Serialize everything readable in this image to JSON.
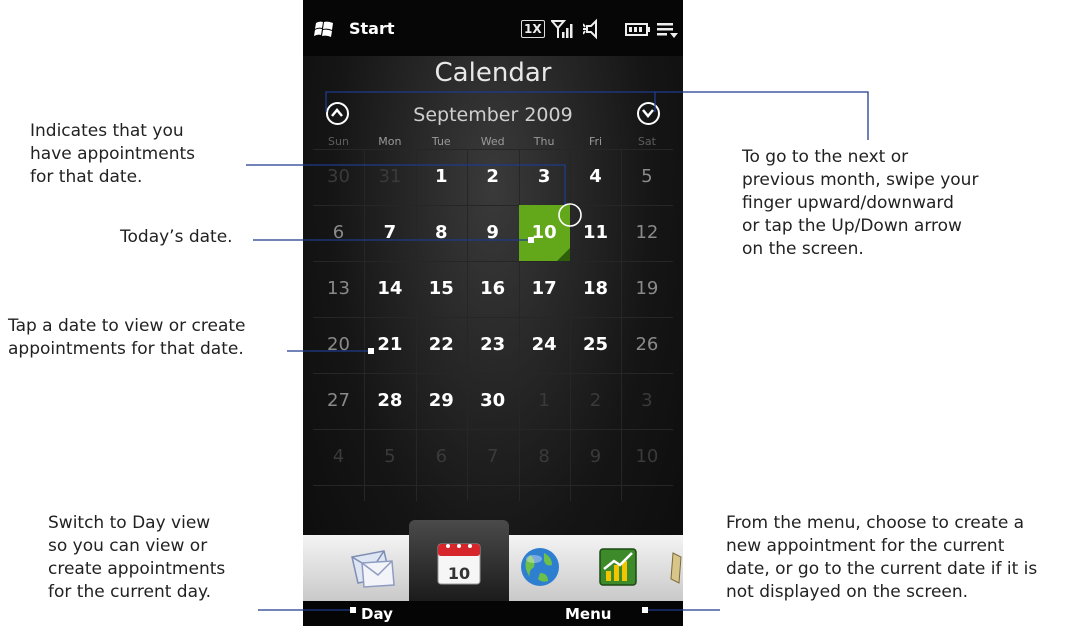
{
  "status_bar": {
    "start_label": "Start",
    "network_badge": "1X",
    "icons": [
      "windows-logo-icon",
      "network-1x-icon",
      "signal-icon",
      "speaker-icon",
      "battery-icon",
      "task-menu-icon"
    ]
  },
  "calendar": {
    "title": "Calendar",
    "month_label": "September 2009",
    "weekdays": [
      "Sun",
      "Mon",
      "Tue",
      "Wed",
      "Thu",
      "Fri",
      "Sat"
    ],
    "weeks": [
      [
        "30",
        "31",
        "1",
        "2",
        "3",
        "4",
        "5"
      ],
      [
        "6",
        "7",
        "8",
        "9",
        "10",
        "11",
        "12"
      ],
      [
        "13",
        "14",
        "15",
        "16",
        "17",
        "18",
        "19"
      ],
      [
        "20",
        "21",
        "22",
        "23",
        "24",
        "25",
        "26"
      ],
      [
        "27",
        "28",
        "29",
        "30",
        "1",
        "2",
        "3"
      ],
      [
        "4",
        "5",
        "6",
        "7",
        "8",
        "9",
        "10"
      ]
    ],
    "today": "10",
    "today_color": "#63a81a"
  },
  "tabs": {
    "active_tab_day": "10",
    "items": [
      "mail-icon",
      "calendar-icon",
      "internet-globe-icon",
      "stocks-icon",
      "more-icon"
    ]
  },
  "softkeys": {
    "left": "Day",
    "right": "Menu"
  },
  "callouts": {
    "appointments": [
      "Indicates that you",
      "have appointments",
      "for that date."
    ],
    "today": [
      "Today’s date."
    ],
    "tap_date": [
      "Tap a date to view or create",
      "appointments for that date."
    ],
    "day_view": [
      "Switch to Day view",
      "so you can view or",
      "create appointments",
      "for the current day."
    ],
    "next_month": [
      "To go to the next or",
      "previous month, swipe your",
      "finger upward/downward",
      "or tap the Up/Down arrow",
      "on the screen."
    ],
    "menu": [
      "From the menu, choose to create a",
      "new appointment for the current",
      "date, or go to the current date if it is",
      "not displayed on the screen."
    ]
  },
  "colors": {
    "leader_line": "#1f3b8c",
    "today_fill": "#63a81a"
  }
}
